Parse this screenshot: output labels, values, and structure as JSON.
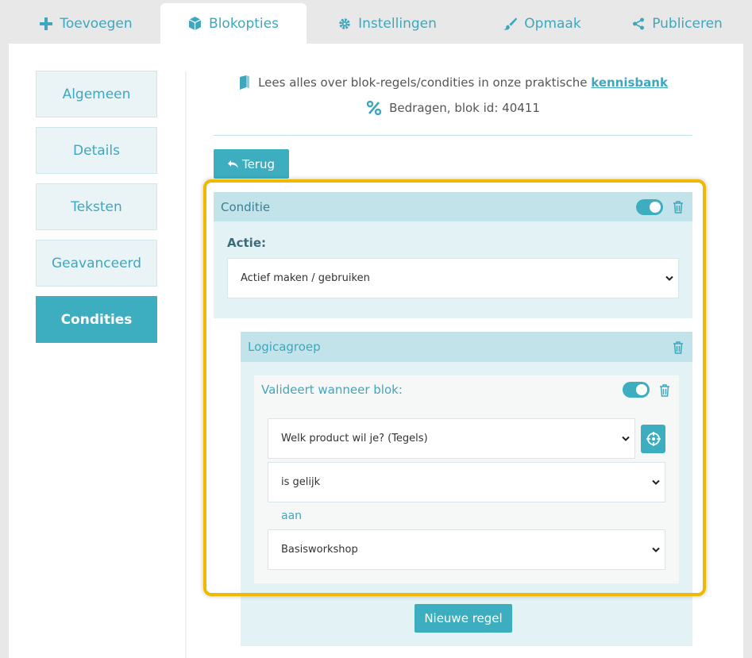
{
  "tabs": [
    {
      "label": "Toevoegen",
      "icon": "plus-icon"
    },
    {
      "label": "Blokopties",
      "icon": "cube-icon",
      "active": true
    },
    {
      "label": "Instellingen",
      "icon": "gear-icon"
    },
    {
      "label": "Opmaak",
      "icon": "brush-icon"
    },
    {
      "label": "Publiceren",
      "icon": "share-icon"
    }
  ],
  "sidebar": {
    "items": [
      {
        "label": "Algemeen"
      },
      {
        "label": "Details"
      },
      {
        "label": "Teksten"
      },
      {
        "label": "Geavanceerd"
      },
      {
        "label": "Condities",
        "active": true
      }
    ]
  },
  "info": {
    "kb_text": "Lees alles over blok-regels/condities in onze praktische",
    "kb_link": "kennisbank",
    "block_text": "Bedragen, blok id: 40411"
  },
  "back_button": "Terug",
  "condition": {
    "title": "Conditie",
    "action_label": "Actie:",
    "action_value": "Actief maken / gebruiken",
    "enabled": true
  },
  "logic_group": {
    "title": "Logicagroep",
    "rule": {
      "title": "Valideert wanneer blok:",
      "enabled": true,
      "field_value": "Welk product wil je? (Tegels)",
      "operator_value": "is gelijk",
      "connector": "aan",
      "target_value": "Basisworkshop"
    }
  },
  "new_rule_button": "Nieuwe regel",
  "colors": {
    "accent": "#3daebf",
    "highlight": "#f0b900",
    "header_bg": "#c3e3ea",
    "body_bg": "#e3f2f5"
  }
}
